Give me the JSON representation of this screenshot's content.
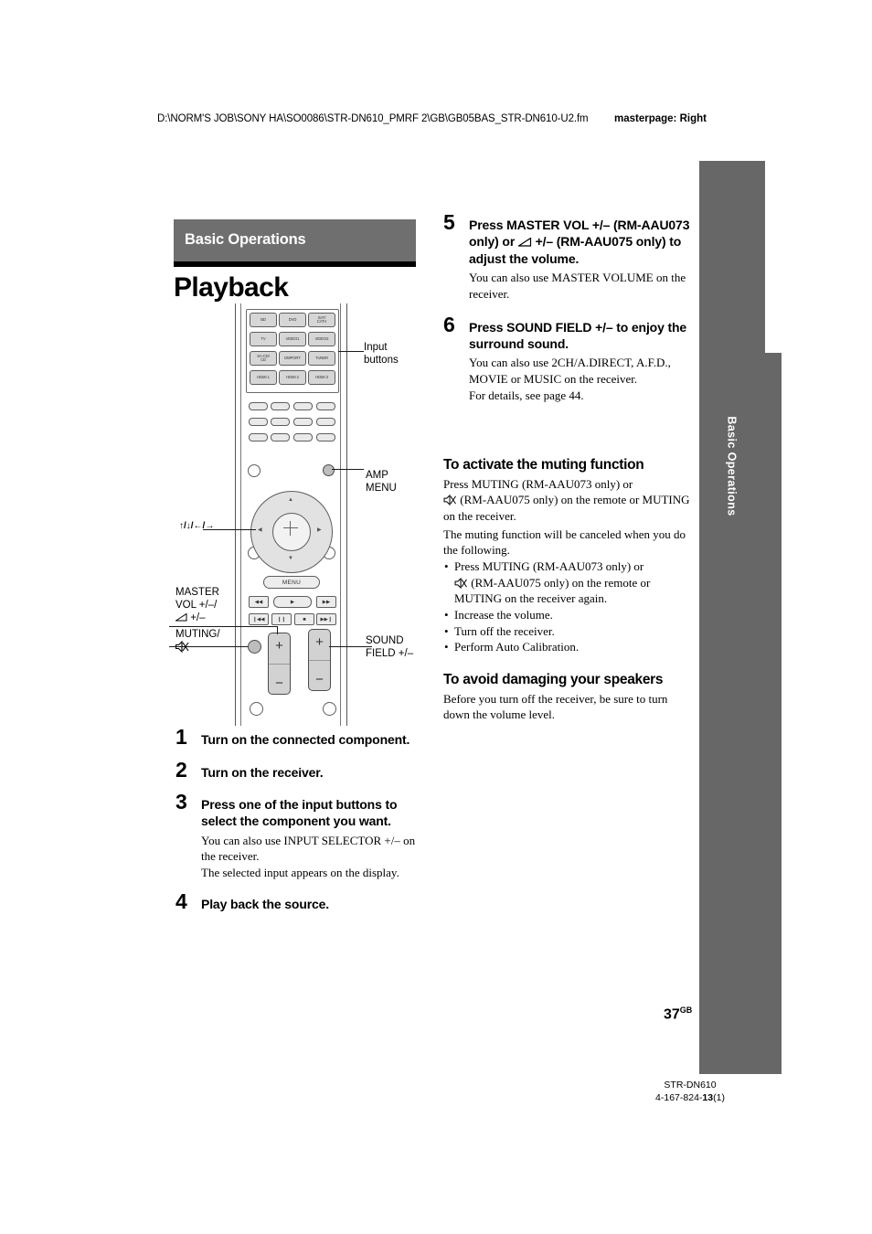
{
  "header": {
    "path": "D:\\NORM'S JOB\\SONY HA\\SO0086\\STR-DN610_PMRF 2\\GB\\GB05BAS_STR-DN610-U2.fm",
    "masterpage": "masterpage: Right"
  },
  "side_tab": {
    "label": "Basic Operations"
  },
  "section": {
    "header": "Basic Operations",
    "title": "Playback"
  },
  "remote": {
    "input_buttons": [
      "BD",
      "DVD",
      "SAT/\nCATV",
      "TV",
      "VIDEO1",
      "VIDEO2",
      "SA-CD/\nCD",
      "DMPORT",
      "TUNER",
      "HDMI 1",
      "HDMI 2",
      "HDMI 3"
    ],
    "menu_label": "MENU",
    "transport_row1": [
      "◀◀",
      "▶",
      "▶▶"
    ],
    "transport_row2": [
      "❙◀◀",
      "❙❙",
      "■",
      "▶▶❙"
    ],
    "vol_plus": "+",
    "vol_minus": "−",
    "sf_plus": "+",
    "sf_minus": "−",
    "callouts": {
      "input_buttons": "Input\nbuttons",
      "amp_menu": "AMP\nMENU",
      "cursor": "↑/↓/←/→",
      "master_vol": "MASTER\nVOL +/−/\n⌀ +/−",
      "master_vol_l1": "MASTER",
      "master_vol_l2": "VOL +/–/",
      "master_vol_l3": "+/–",
      "muting_l1": "MUTING/",
      "sound_field_l1": "SOUND",
      "sound_field_l2": "FIELD +/–"
    }
  },
  "steps_left": [
    {
      "num": "1",
      "head": "Turn on the connected component.",
      "sub": []
    },
    {
      "num": "2",
      "head": "Turn on the receiver.",
      "sub": []
    },
    {
      "num": "3",
      "head": "Press one of the input buttons to select the component you want.",
      "sub": [
        "You can also use INPUT SELECTOR +/– on the receiver.",
        "The selected input appears on the display."
      ]
    },
    {
      "num": "4",
      "head": "Play back the source.",
      "sub": []
    }
  ],
  "steps_right": [
    {
      "num": "5",
      "head_p1": "Press MASTER VOL +/– (RM-AAU073 only) or ",
      "head_p2": " +/– (RM-AAU075 only) to adjust the volume.",
      "sub": [
        "You can also use MASTER VOLUME on the receiver."
      ]
    },
    {
      "num": "6",
      "head_p1": "Press SOUND FIELD +/– to enjoy the surround sound.",
      "head_p2": "",
      "sub": [
        "You can also use 2CH/A.DIRECT, A.F.D., MOVIE or MUSIC on the receiver.",
        "For details, see page 44."
      ]
    }
  ],
  "muting_section": {
    "title": "To activate the muting function",
    "p1_a": "Press MUTING (RM-AAU073 only) or",
    "p1_b": "(RM-AAU075 only) on the remote or MUTING on the receiver.",
    "p2": "The muting function will be canceled when you do the following.",
    "bullets": [
      {
        "a": "Press MUTING (RM-AAU073 only) or",
        "b": "(RM-AAU075 only) on the remote or MUTING on the receiver again."
      },
      {
        "a": "Increase the volume.",
        "b": ""
      },
      {
        "a": "Turn off the receiver.",
        "b": ""
      },
      {
        "a": "Perform Auto Calibration.",
        "b": ""
      }
    ]
  },
  "speakers_section": {
    "title": "To avoid damaging your speakers",
    "body": "Before you turn off the receiver, be sure to turn down the volume level."
  },
  "page_number": {
    "num": "37",
    "sup": "GB"
  },
  "footer": {
    "model": "STR-DN610",
    "code_a": "4-167-824-",
    "code_b": "13",
    "code_c": "(1)"
  },
  "colors": {
    "gray": "#676767",
    "header_gray": "#6f6f6f",
    "black": "#000000"
  }
}
